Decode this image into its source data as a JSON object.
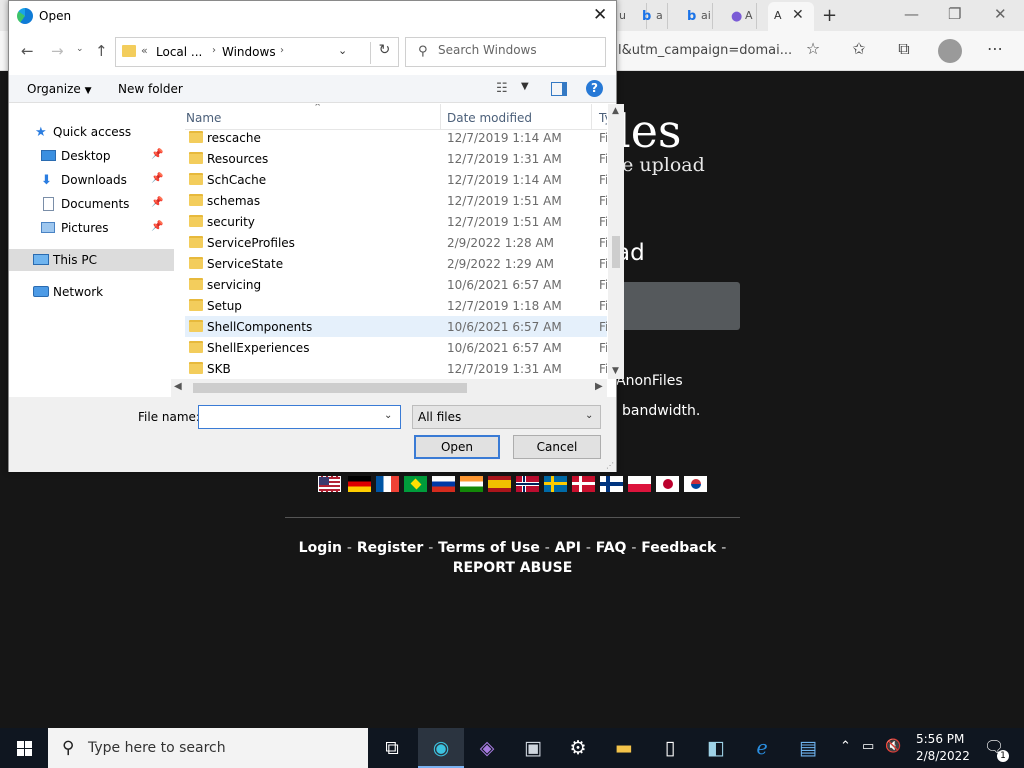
{
  "browser": {
    "tabs": [
      {
        "icon": "b",
        "label": "a"
      },
      {
        "icon": "b",
        "label": "ai"
      },
      {
        "icon": "●",
        "label": "A"
      }
    ],
    "active_tab_label": "A",
    "url_tail": "l&utm_campaign=domai..."
  },
  "page": {
    "title": "les",
    "subtitle": "le upload",
    "heading": "ad",
    "line1": "AnonFiles",
    "line2": "bandwidth.",
    "footer_links": [
      "Login",
      "Register",
      "Terms of Use",
      "API",
      "FAQ",
      "Feedback",
      "REPORT ABUSE"
    ],
    "footer_sep": "-"
  },
  "dialog": {
    "title": "Open",
    "address": {
      "seg1": "Local ...",
      "seg2": "Windows"
    },
    "search_placeholder": "Search Windows",
    "toolbar": {
      "organize": "Organize",
      "new_folder": "New folder",
      "help": "?"
    },
    "nav": {
      "quick_access": "Quick access",
      "desktop": "Desktop",
      "downloads": "Downloads",
      "documents": "Documents",
      "pictures": "Pictures",
      "this_pc": "This PC",
      "network": "Network"
    },
    "columns": {
      "name": "Name",
      "date": "Date modified",
      "type": "Ty"
    },
    "files": [
      {
        "name": "rescache",
        "date": "12/7/2019 1:14 AM",
        "type": "Fi"
      },
      {
        "name": "Resources",
        "date": "12/7/2019 1:31 AM",
        "type": "Fi"
      },
      {
        "name": "SchCache",
        "date": "12/7/2019 1:14 AM",
        "type": "Fi"
      },
      {
        "name": "schemas",
        "date": "12/7/2019 1:51 AM",
        "type": "Fi"
      },
      {
        "name": "security",
        "date": "12/7/2019 1:51 AM",
        "type": "Fi"
      },
      {
        "name": "ServiceProfiles",
        "date": "2/9/2022 1:28 AM",
        "type": "Fi"
      },
      {
        "name": "ServiceState",
        "date": "2/9/2022 1:29 AM",
        "type": "Fi"
      },
      {
        "name": "servicing",
        "date": "10/6/2021 6:57 AM",
        "type": "Fi"
      },
      {
        "name": "Setup",
        "date": "12/7/2019 1:18 AM",
        "type": "Fi"
      },
      {
        "name": "ShellComponents",
        "date": "10/6/2021 6:57 AM",
        "type": "Fi"
      },
      {
        "name": "ShellExperiences",
        "date": "10/6/2021 6:57 AM",
        "type": "Fi"
      },
      {
        "name": "SKB",
        "date": "12/7/2019 1:31 AM",
        "type": "Fi"
      }
    ],
    "file_name_label": "File name:",
    "file_name_value": "",
    "file_type": "All files",
    "open_button": "Open",
    "cancel_button": "Cancel"
  },
  "taskbar": {
    "search_placeholder": "Type here to search",
    "time": "5:56 PM",
    "date": "2/8/2022",
    "notification_count": "1"
  }
}
